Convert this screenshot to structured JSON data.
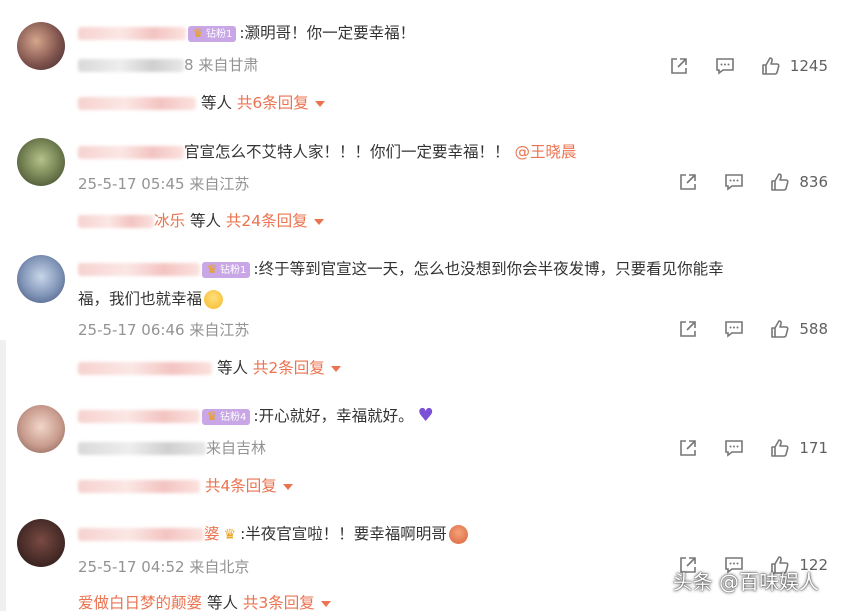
{
  "comments": [
    {
      "text": ":灏明哥！你一定要幸福！",
      "badge": "钻粉1",
      "date": "8",
      "location": "来自甘肃",
      "likes": "1245",
      "reply_suffix": "等人",
      "reply_count": "共6条回复"
    },
    {
      "text": "官宣怎么不艾特人家！！！你们一定要幸福！！",
      "mention": "@王晓晨",
      "date": "25-5-17 05:45",
      "location": "来自江苏",
      "likes": "836",
      "reply_names": "冰乐",
      "reply_suffix": "等人",
      "reply_count": "共24条回复"
    },
    {
      "text_line1": ":终于等到官宣这一天，怎么也没想到你会半夜发博，只要看见你能幸",
      "text_line2": "福，我们也就幸福",
      "badge": "钻粉1",
      "date": "25-5-17 06:46",
      "location": "来自江苏",
      "likes": "588",
      "reply_suffix": "等人",
      "reply_count": "共2条回复"
    },
    {
      "text": ":开心就好，幸福就好。",
      "badge": "钻粉4",
      "location": "来自吉林",
      "likes": "171",
      "reply_count": "共4条回复"
    },
    {
      "text": ":半夜官宣啦！！要幸福啊明哥",
      "name_tail": "婆",
      "date": "25-5-17 04:52",
      "location": "来自北京",
      "likes": "122",
      "reply_names": "爱做白日梦的颠婆",
      "reply_suffix": "等人",
      "reply_count": "共3条回复"
    }
  ],
  "watermark": "头条 @百味娱人",
  "colors": {
    "accent": "#eb7350",
    "meta": "#939393",
    "badge": "#c9a6e6"
  }
}
